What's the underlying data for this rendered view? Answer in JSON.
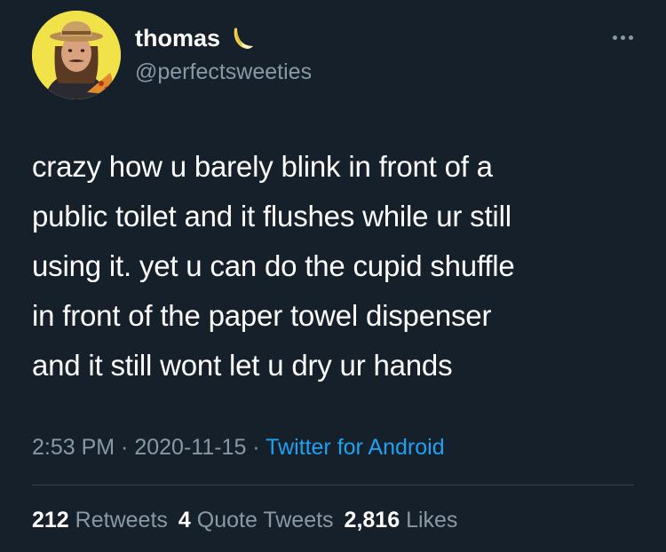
{
  "colors": {
    "background": "#15202b",
    "text_primary": "#ffffff",
    "text_secondary": "#8899a6",
    "link": "#1da1f2",
    "divider": "#38444d",
    "avatar_bg": "#f2e24a"
  },
  "user": {
    "display_name": "thomas",
    "name_emoji": "banana-icon",
    "handle": "@perfectsweeties",
    "avatar": "avatar-photo"
  },
  "tweet": {
    "text": "crazy how u barely blink in front of a\npublic toilet and it flushes while ur still\nusing it. yet u can do the cupid shuffle\nin front of the paper towel dispenser\nand it still wont let u dry ur hands"
  },
  "meta": {
    "time": "2:53 PM",
    "separator": " · ",
    "date": "2020-11-15",
    "source": "Twitter for Android"
  },
  "stats": {
    "retweets_count": "212",
    "retweets_label": "Retweets",
    "quotes_count": "4",
    "quotes_label": "Quote Tweets",
    "likes_count": "2,816",
    "likes_label": "Likes"
  },
  "icons": {
    "more": "more-icon"
  }
}
